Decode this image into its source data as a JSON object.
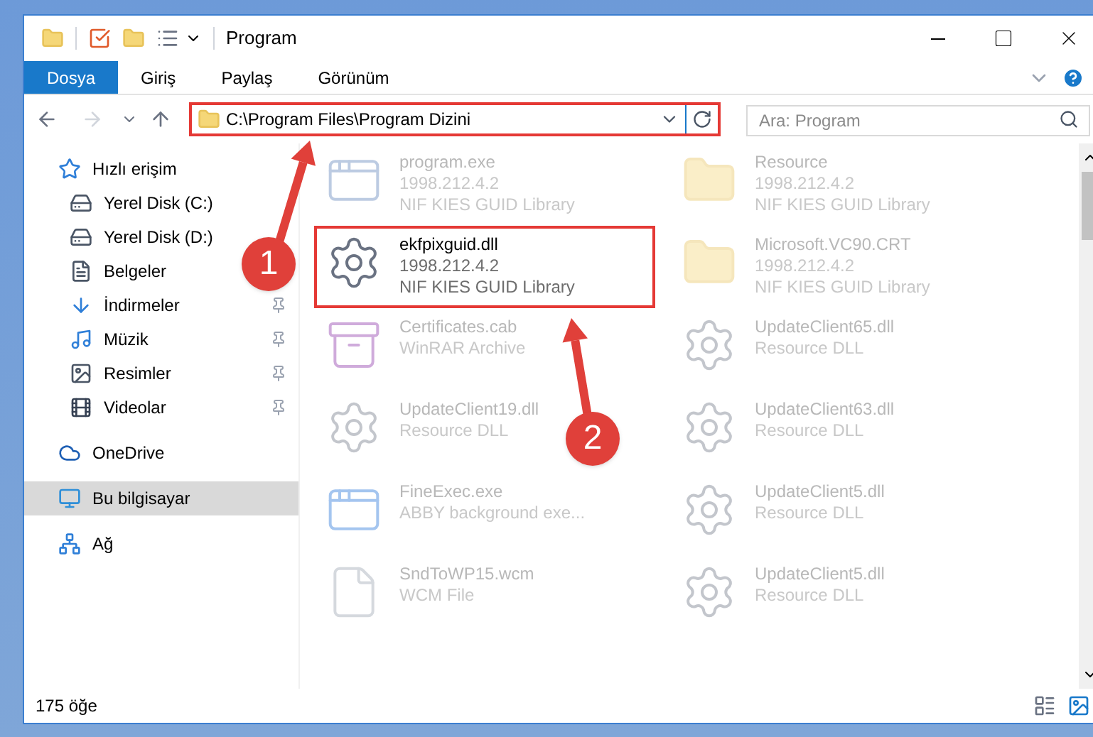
{
  "window": {
    "title": "Program"
  },
  "ribbon_tabs": [
    {
      "label": "Dosya",
      "selected": true
    },
    {
      "label": "Giriş",
      "selected": false
    },
    {
      "label": "Paylaş",
      "selected": false
    },
    {
      "label": "Görünüm",
      "selected": false
    }
  ],
  "address_bar": {
    "path": "C:\\Program Files\\Program Dizini",
    "highlighted": true
  },
  "search": {
    "placeholder": "Ara: Program"
  },
  "sidebar": {
    "items": [
      {
        "label": "Hızlı erişim",
        "kind": "star",
        "selected": false,
        "children": [
          {
            "label": "Yerel Disk (C:)",
            "kind": "disk",
            "pinned": false,
            "selected": false
          },
          {
            "label": "Yerel Disk (D:)",
            "kind": "disk",
            "pinned": false,
            "selected": false
          },
          {
            "label": "Belgeler",
            "kind": "docs",
            "pinned": false,
            "selected": false
          },
          {
            "label": "İndirmeler",
            "kind": "download",
            "pinned": true,
            "selected": false
          },
          {
            "label": "Müzik",
            "kind": "music",
            "pinned": true,
            "selected": false
          },
          {
            "label": "Resimler",
            "kind": "pictures",
            "pinned": true,
            "selected": false
          },
          {
            "label": "Videolar",
            "kind": "videos",
            "pinned": true,
            "selected": false
          }
        ]
      },
      {
        "label": "OneDrive",
        "kind": "cloud",
        "selected": false
      },
      {
        "label": "Bu bilgisayar",
        "kind": "pc",
        "selected": true
      },
      {
        "label": "Ağ",
        "kind": "network",
        "selected": false
      }
    ]
  },
  "files": [
    {
      "name": "program.exe",
      "kind": "exe",
      "details": [
        "1998.212.4.2",
        "NIF KIES GUID Library"
      ],
      "emphasized": false
    },
    {
      "name": "Resource",
      "kind": "folder",
      "details": [
        "1998.212.4.2",
        "NIF KIES GUID Library"
      ],
      "emphasized": false
    },
    {
      "name": "ekfpixguid.dll",
      "kind": "dll",
      "details": [
        "1998.212.4.2",
        "NIF KIES GUID Library"
      ],
      "emphasized": true
    },
    {
      "name": "Microsoft.VC90.CRT",
      "kind": "folder",
      "details": [
        "1998.212.4.2",
        "NIF KIES GUID Library"
      ],
      "emphasized": false
    },
    {
      "name": "Certificates.cab",
      "kind": "archive",
      "details": [
        "WinRAR Archive"
      ],
      "emphasized": false
    },
    {
      "name": "UpdateClient65.dll",
      "kind": "dll",
      "details": [
        "Resource DLL"
      ],
      "emphasized": false
    },
    {
      "name": "UpdateClient19.dll",
      "kind": "dll",
      "details": [
        "Resource DLL"
      ],
      "emphasized": false
    },
    {
      "name": "UpdateClient63.dll",
      "kind": "dll",
      "details": [
        "Resource DLL"
      ],
      "emphasized": false
    },
    {
      "name": "FineExec.exe",
      "kind": "app",
      "details": [
        "ABBY background exe..."
      ],
      "emphasized": false
    },
    {
      "name": "UpdateClient5.dll",
      "kind": "dll",
      "details": [
        "Resource DLL"
      ],
      "emphasized": false
    },
    {
      "name": "SndToWP15.wcm",
      "kind": "file",
      "details": [
        "WCM File"
      ],
      "emphasized": false
    },
    {
      "name": "UpdateClient5.dll",
      "kind": "dll",
      "details": [
        "Resource DLL"
      ],
      "emphasized": false
    }
  ],
  "status_bar": {
    "count": "175 öğe"
  },
  "callouts": [
    {
      "number": "1"
    },
    {
      "number": "2"
    }
  ]
}
